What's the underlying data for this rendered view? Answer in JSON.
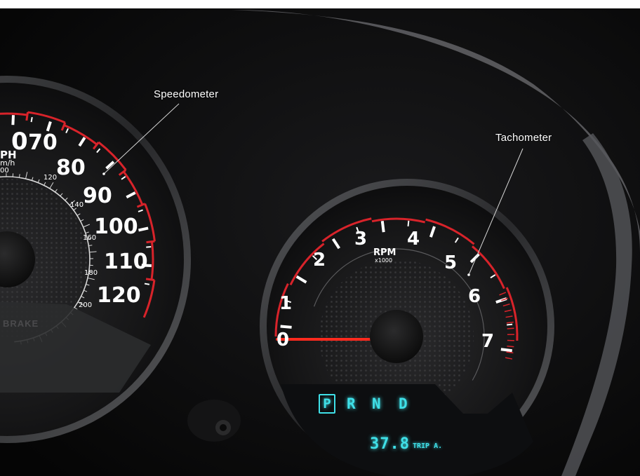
{
  "callouts": {
    "speedometer": "Speedometer",
    "tachometer": "Tachometer"
  },
  "speedometer": {
    "mph_labels": [
      "70",
      "80",
      "90",
      "100",
      "110",
      "120"
    ],
    "kmh_labels": [
      "120",
      "140",
      "160",
      "180",
      "200"
    ],
    "unit_mph": "PH",
    "unit_kmh": "m/h",
    "partial_top_label": "0",
    "partial_kmh_label": "00",
    "brake_label": "BRAKE"
  },
  "tachometer": {
    "rpm_labels": [
      "0",
      "1",
      "2",
      "3",
      "4",
      "5",
      "6",
      "7"
    ],
    "unit": "RPM",
    "multiplier": "x1000"
  },
  "display": {
    "gear_selected": "P",
    "gears_other": [
      "R",
      "N",
      "D"
    ],
    "trip_value": "37.8",
    "trip_label": "TRIP A."
  },
  "colors": {
    "redline": "#d8232a",
    "lcd": "#3fe0e8",
    "needle": "#ff2a1e"
  }
}
